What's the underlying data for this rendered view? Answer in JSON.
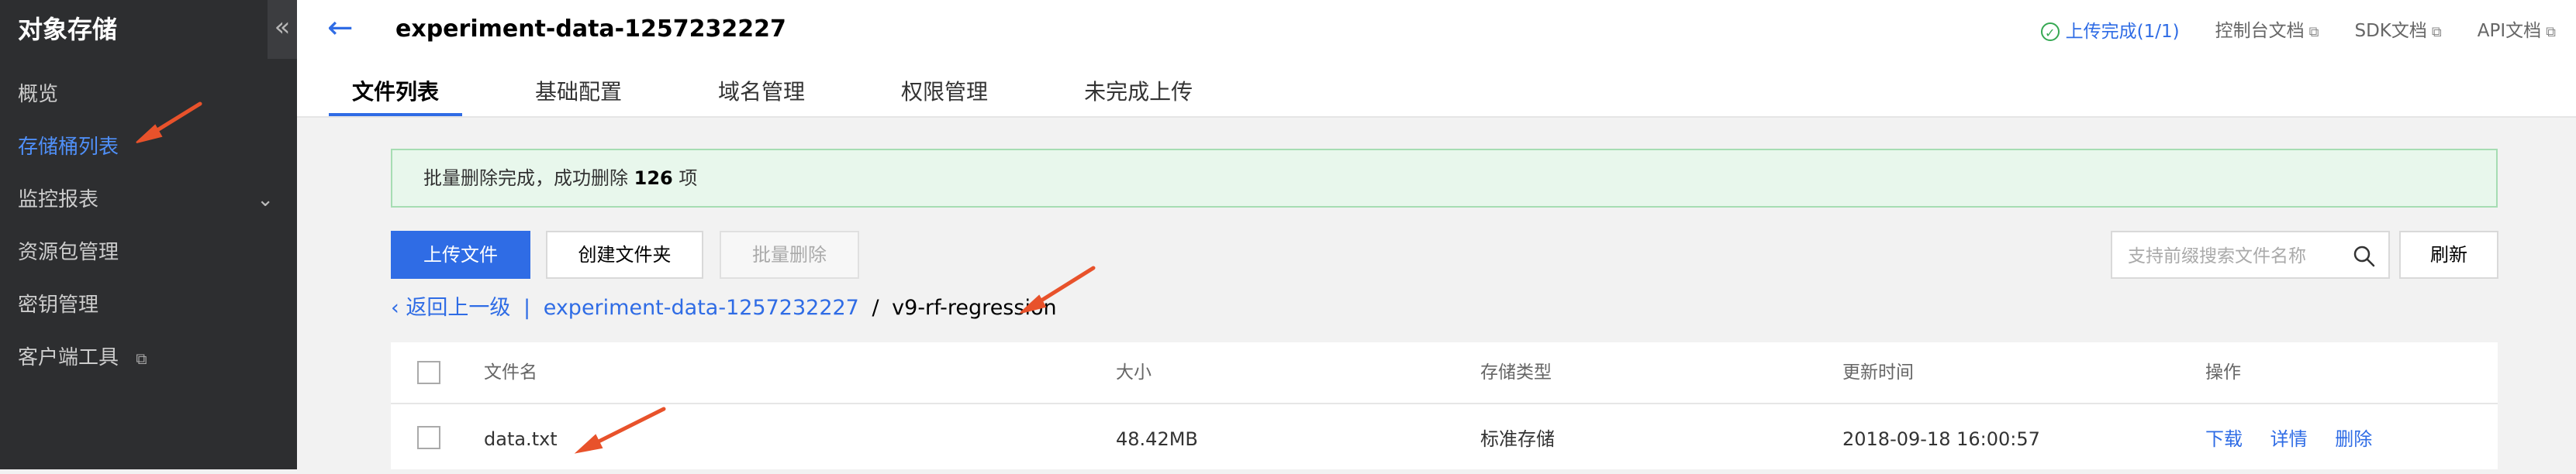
{
  "sidebar": {
    "title": "对象存储",
    "collapse_glyph": "«",
    "items": [
      {
        "label": "概览"
      },
      {
        "label": "存储桶列表"
      },
      {
        "label": "监控报表"
      },
      {
        "label": "资源包管理"
      },
      {
        "label": "密钥管理"
      },
      {
        "label": "客户端工具"
      }
    ]
  },
  "header": {
    "back_glyph": "←",
    "bucket_name": "experiment-data-1257232227",
    "upload_status": "上传完成(1/1)",
    "links": [
      "控制台文档",
      "SDK文档",
      "API文档"
    ]
  },
  "tabs": [
    "文件列表",
    "基础配置",
    "域名管理",
    "权限管理",
    "未完成上传"
  ],
  "alert": {
    "prefix": "批量删除完成，成功删除",
    "count": "126",
    "suffix": "项"
  },
  "toolbar": {
    "upload": "上传文件",
    "create_folder": "创建文件夹",
    "batch_delete": "批量删除",
    "search_placeholder": "支持前缀搜索文件名称",
    "refresh": "刷新"
  },
  "breadcrumb": {
    "back": "返回上一级",
    "bucket": "experiment-data-1257232227",
    "separator": "/",
    "folder": "v9-rf-regression"
  },
  "table": {
    "columns": [
      "文件名",
      "大小",
      "存储类型",
      "更新时间",
      "操作"
    ],
    "rows": [
      {
        "name": "data.txt",
        "size": "48.42MB",
        "storage": "标准存储",
        "updated": "2018-09-18 16:00:57",
        "actions": [
          "下载",
          "详情",
          "删除"
        ]
      }
    ]
  },
  "colors": {
    "accent": "#2f6ce5",
    "sidebar_bg": "#2d2e30",
    "success": "#35a852",
    "annotation_arrow": "#e8522b"
  }
}
